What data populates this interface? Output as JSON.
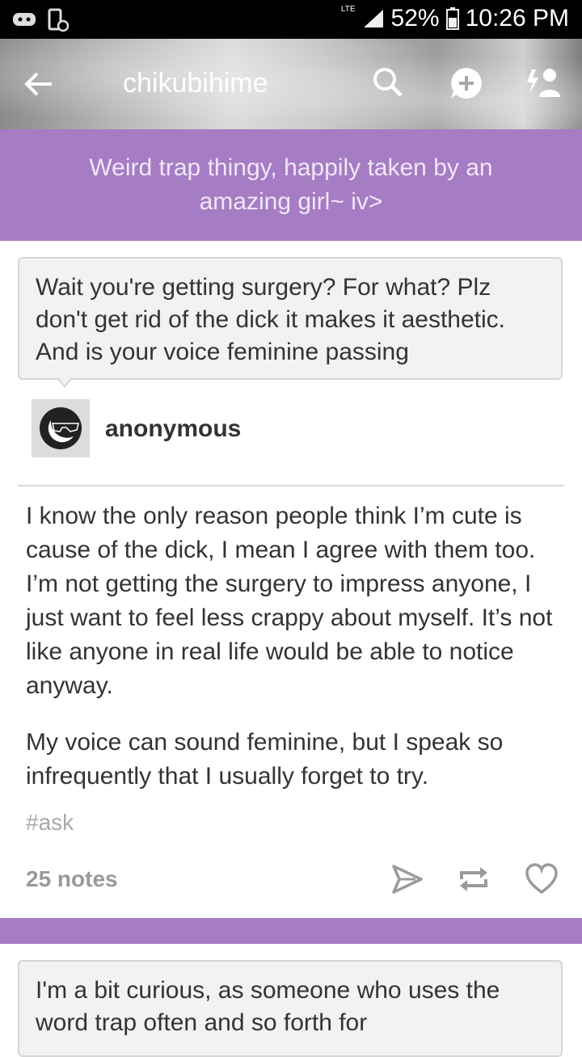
{
  "status_bar": {
    "network": "LTE",
    "battery": "52%",
    "time": "10:26 PM"
  },
  "header": {
    "title": "chikubihime",
    "icons": [
      "back-arrow-icon",
      "search-icon",
      "compose-icon",
      "follow-icon"
    ]
  },
  "blog_description": "Weird trap thingy, happily taken by an amazing girl~ iv>",
  "post": {
    "question": "Wait you're getting surgery? For what? Plz don't get rid of the dick it makes it aesthetic. And is your voice feminine passing",
    "asker": "anonymous",
    "answer_paragraphs": [
      "I know the only reason people think I’m cute is cause of the dick, I mean I agree with them too. I’m not getting the surgery to impress anyone, I just want to feel less crappy about myself. It’s not like anyone in real life would be able to notice anyway.",
      "My voice can sound feminine, but I speak so infrequently that I usually forget to try."
    ],
    "tag": "#ask",
    "notes": "25 notes"
  },
  "next_post": {
    "question_partial": "I'm a bit curious, as someone who uses the word trap often and so forth for"
  },
  "colors": {
    "accent_purple": "#a67cc4",
    "status_bar": "#000000"
  }
}
